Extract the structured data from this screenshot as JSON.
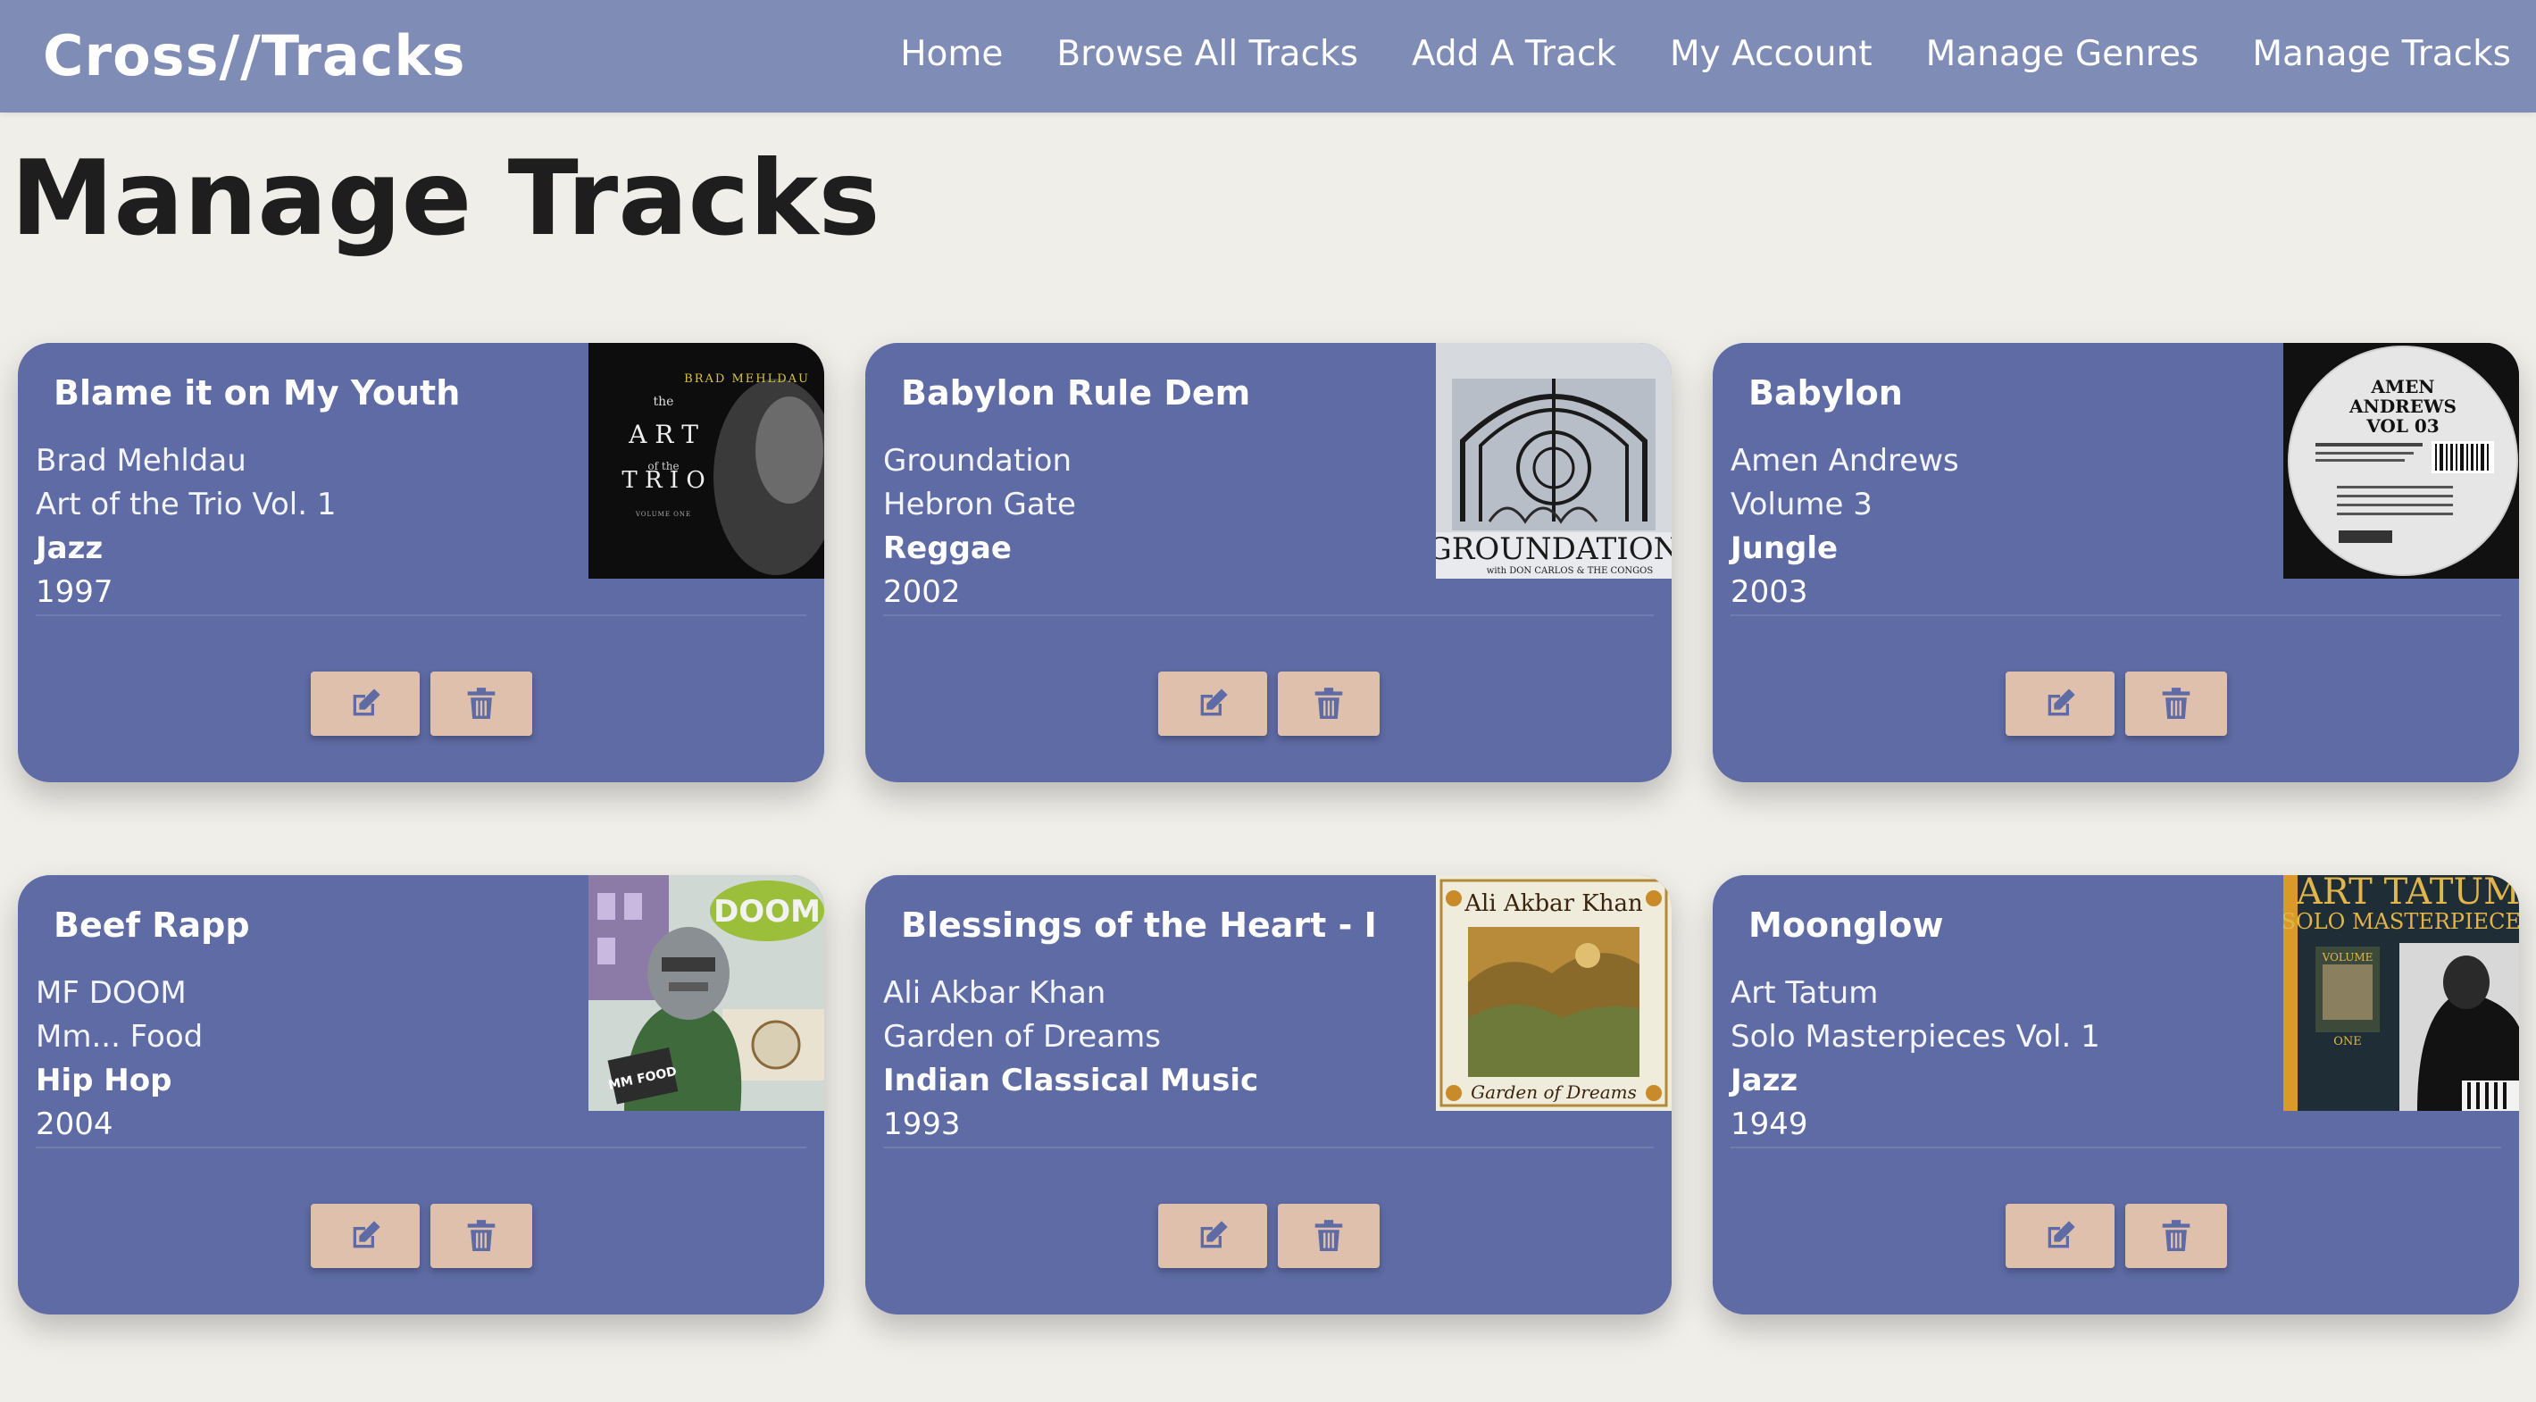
{
  "app": {
    "brand": "Cross//Tracks"
  },
  "nav": {
    "home": "Home",
    "browse": "Browse All Tracks",
    "add": "Add A Track",
    "account": "My Account",
    "genres": "Manage Genres",
    "tracks": "Manage Tracks"
  },
  "page": {
    "title": "Manage Tracks"
  },
  "colors": {
    "navbar": "#7e8cb6",
    "background": "#f0eee9",
    "card": "#5e6ba4",
    "button": "#dfc0ad",
    "button_icon": "#5e6ba4"
  },
  "icons": {
    "edit": "edit-icon",
    "delete": "trash-icon"
  },
  "tracks": [
    {
      "title": "Blame it on My Youth",
      "artist": "Brad Mehldau",
      "album": "Art of the Trio Vol. 1",
      "genre": "Jazz",
      "year": "1997",
      "cover_text": [
        "BRAD MEHLDAU",
        "the",
        "A R T",
        "of the",
        "T R I O",
        "VOLUME ONE"
      ]
    },
    {
      "title": "Babylon Rule Dem",
      "artist": "Groundation",
      "album": "Hebron Gate",
      "genre": "Reggae",
      "year": "2002",
      "cover_text": [
        "GROUNDATION",
        "with DON CARLOS & THE CONGOS"
      ]
    },
    {
      "title": "Babylon",
      "artist": "Amen Andrews",
      "album": "Volume 3",
      "genre": "Jungle",
      "year": "2003",
      "cover_text": [
        "AMEN",
        "ANDREWS",
        "VOL 03"
      ]
    },
    {
      "title": "Beef Rapp",
      "artist": "MF DOOM",
      "album": "Mm... Food",
      "genre": "Hip Hop",
      "year": "2004",
      "cover_text": [
        "DOOM",
        "MM FOOD"
      ]
    },
    {
      "title": "Blessings of the Heart - I",
      "artist": "Ali Akbar Khan",
      "album": "Garden of Dreams",
      "genre": "Indian Classical Music",
      "year": "1993",
      "cover_text": [
        "Ali Akbar Khan",
        "Garden of Dreams"
      ]
    },
    {
      "title": "Moonglow",
      "artist": "Art Tatum",
      "album": "Solo Masterpieces Vol. 1",
      "genre": "Jazz",
      "year": "1949",
      "cover_text": [
        "ART TATUM",
        "SOLO MASTERPIECES",
        "VOLUME",
        "ONE"
      ]
    }
  ]
}
